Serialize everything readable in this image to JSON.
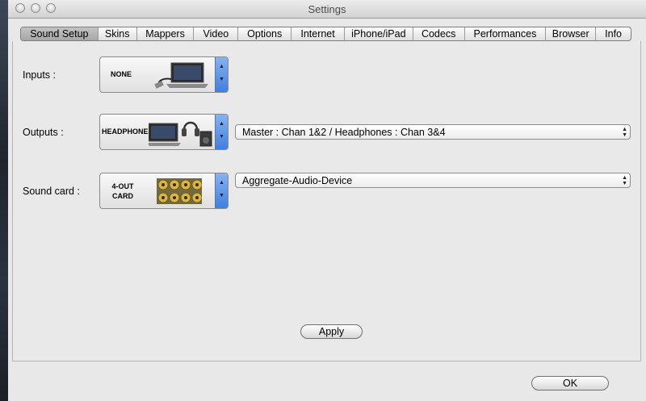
{
  "window": {
    "title": "Settings"
  },
  "tabs": [
    {
      "label": "Sound Setup",
      "active": true
    },
    {
      "label": "Skins"
    },
    {
      "label": "Mappers"
    },
    {
      "label": "Video"
    },
    {
      "label": "Options"
    },
    {
      "label": "Internet"
    },
    {
      "label": "iPhone/iPad"
    },
    {
      "label": "Codecs"
    },
    {
      "label": "Performances"
    },
    {
      "label": "Browser"
    },
    {
      "label": "Info"
    }
  ],
  "inputs": {
    "label": "Inputs :",
    "picker_text": "NONE"
  },
  "outputs": {
    "label": "Outputs :",
    "picker_text": "HEADPHONES",
    "select_value": "Master : Chan 1&2 / Headphones : Chan 3&4"
  },
  "soundcard": {
    "label": "Sound card :",
    "picker_text_line1": "4-OUT",
    "picker_text_line2": "CARD",
    "select_value": "Aggregate-Audio-Device"
  },
  "buttons": {
    "apply": "Apply",
    "ok": "OK"
  },
  "icons": {
    "stepper_up": "▲",
    "stepper_down": "▼",
    "select_arrows_up": "▲",
    "select_arrows_down": "▼"
  },
  "colors": {
    "stepper_accent": "#3f7fe0",
    "window_bg": "#e8e8e8"
  }
}
